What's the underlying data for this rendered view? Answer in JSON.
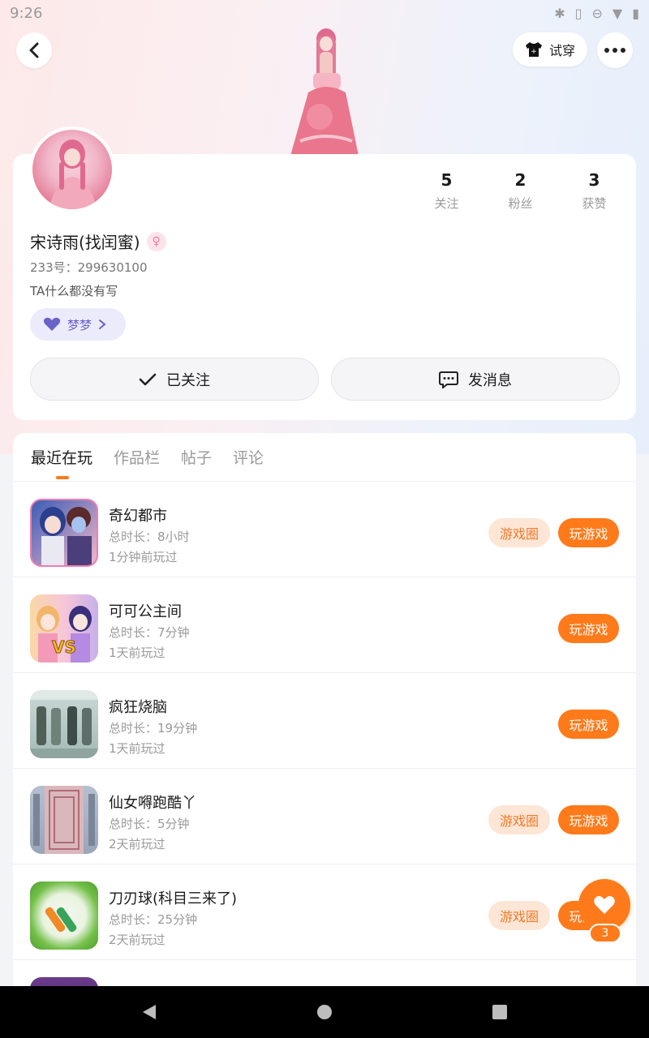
{
  "status_bar": {
    "time": "9:26"
  },
  "header": {
    "tryon_label": "试穿"
  },
  "profile": {
    "nickname": "宋诗雨(找闰蜜)",
    "gender_symbol": "♀",
    "uid": "233号：299630100",
    "bio": "TA什么都没有写",
    "tag_label": "梦梦",
    "stats": [
      {
        "value": "5",
        "label": "关注"
      },
      {
        "value": "2",
        "label": "粉丝"
      },
      {
        "value": "3",
        "label": "获赞"
      }
    ],
    "follow_label": "已关注",
    "message_label": "发消息"
  },
  "tabs": [
    {
      "label": "最近在玩",
      "active": true
    },
    {
      "label": "作品栏",
      "active": false
    },
    {
      "label": "帖子",
      "active": false
    },
    {
      "label": "评论",
      "active": false
    }
  ],
  "games": [
    {
      "title": "奇幻都市",
      "duration": "总时长：8小时",
      "last_played": "1分钟前玩过",
      "circle_label": "游戏圈",
      "play_label": "玩游戏",
      "icon_colors": [
        "#3c5db5",
        "#f3b7c9"
      ]
    },
    {
      "title": "可可公主间",
      "duration": "总时长：7分钟",
      "last_played": "1天前玩过",
      "circle_label": "",
      "play_label": "玩游戏",
      "icon_colors": [
        "#f8c37a",
        "#b48be0"
      ]
    },
    {
      "title": "疯狂烧脑",
      "duration": "总时长：19分钟",
      "last_played": "1天前玩过",
      "circle_label": "",
      "play_label": "玩游戏",
      "icon_colors": [
        "#7fa3a0",
        "#c9d6d2"
      ]
    },
    {
      "title": "仙女嘚跑酷丫",
      "duration": "总时长：5分钟",
      "last_played": "2天前玩过",
      "circle_label": "游戏圈",
      "play_label": "玩游戏",
      "icon_colors": [
        "#a7b3c9",
        "#e2c2c8"
      ]
    },
    {
      "title": "刀刃球(科目三来了)",
      "duration": "总时长：25分钟",
      "last_played": "2天前玩过",
      "circle_label": "游戏圈",
      "play_label": "玩游戏",
      "icon_colors": [
        "#6ec040",
        "#eef4e6"
      ]
    }
  ],
  "fab": {
    "count": "3"
  },
  "colors": {
    "accent": "#ff7a1a",
    "circle_bg": "#fde6d6",
    "tag_bg": "#ecebfc"
  }
}
